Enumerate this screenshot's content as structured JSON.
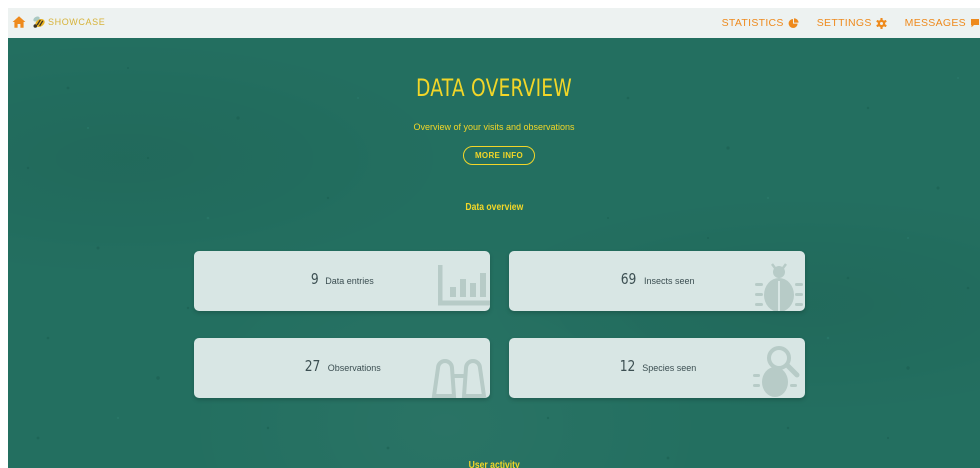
{
  "header": {
    "logo_text": "SHOWCASE",
    "nav": [
      {
        "label": "STATISTICS",
        "icon": "pie-chart-icon"
      },
      {
        "label": "SETTINGS",
        "icon": "gear-icon"
      },
      {
        "label": "MESSAGES",
        "icon": "chat-bubble-icon"
      }
    ]
  },
  "hero": {
    "title": "DATA OVERVIEW",
    "subtitle": "Overview of your visits and observations",
    "more_info_label": "MORE INFO"
  },
  "overview": {
    "section_title": "Data overview",
    "cards": [
      {
        "value": "9",
        "label": "Data entries",
        "icon": "bar-chart-icon"
      },
      {
        "value": "69",
        "label": "Insects seen",
        "icon": "beetle-icon"
      },
      {
        "value": "27",
        "label": "Observations",
        "icon": "binoculars-icon"
      },
      {
        "value": "12",
        "label": "Species seen",
        "icon": "beetle-magnifier-icon"
      }
    ]
  },
  "activity": {
    "section_title": "User activity"
  },
  "colors": {
    "background": "#236f60",
    "accent_yellow": "#f2d628",
    "nav_orange": "#ee8a1d",
    "card": "#d8e6e4",
    "topbar": "#edf2f1"
  }
}
